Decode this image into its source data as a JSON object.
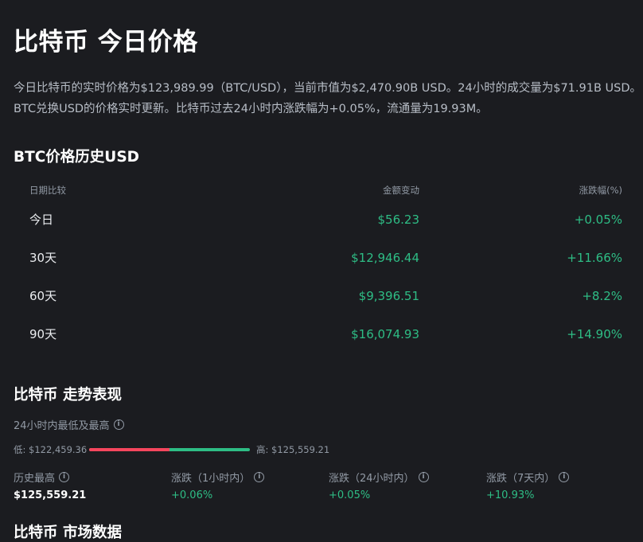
{
  "page": {
    "title": "比特币 今日价格",
    "description": "今日比特币的实时价格为$123,989.99（BTC/USD），当前市值为$2,470.90B USD。24小时的成交量为$71.91B USD。BTC兑换USD的价格实时更新。比特币过去24小时内涨跌幅为+0.05%，流通量为19.93M。"
  },
  "history": {
    "title": "BTC价格历史USD",
    "headers": {
      "period": "日期比较",
      "change": "金额变动",
      "pct": "涨跌幅(%)"
    },
    "rows": [
      {
        "period": "今日",
        "change": "$56.23",
        "pct": "+0.05%"
      },
      {
        "period": "30天",
        "change": "$12,946.44",
        "pct": "+11.66%"
      },
      {
        "period": "60天",
        "change": "$9,396.51",
        "pct": "+8.2%"
      },
      {
        "period": "90天",
        "change": "$16,074.93",
        "pct": "+14.90%"
      }
    ]
  },
  "trend": {
    "title": "比特币 走势表现",
    "range_label": "24小时内最低及最高",
    "low": "低: $122,459.36",
    "high": "高: $125,559.21",
    "low_share": 0.5,
    "stats": [
      {
        "label": "历史最高",
        "value": "$125,559.21"
      },
      {
        "label": "涨跌（1小时内）",
        "value": "+0.06%"
      },
      {
        "label": "涨跌（24小时内）",
        "value": "+0.05%"
      },
      {
        "label": "涨跌（7天内）",
        "value": "+10.93%"
      }
    ]
  },
  "next_section": {
    "title": "比特币 市场数据"
  },
  "colors": {
    "background": "#1b1c20",
    "positive": "#2ebd85",
    "negative": "#f6465d",
    "muted": "#929aa5"
  },
  "icons": {
    "info": "info-circle-icon"
  }
}
